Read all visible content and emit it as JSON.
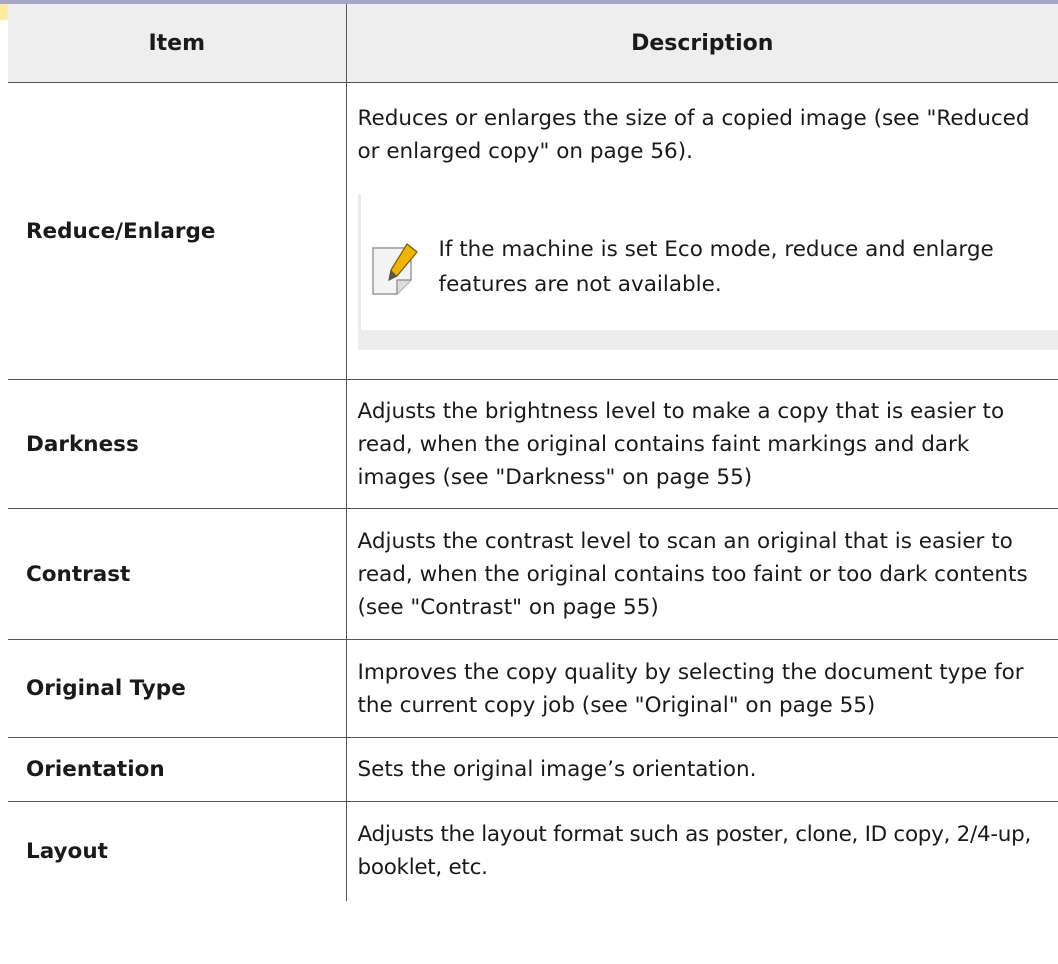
{
  "table": {
    "headers": {
      "item": "Item",
      "description": "Description"
    },
    "rows": [
      {
        "item": "Reduce/Enlarge",
        "description": "Reduces or enlarges the size of a copied image (see \"Reduced or enlarged copy\" on page 56).",
        "note": "If the machine is set Eco mode, reduce and enlarge features are not available."
      },
      {
        "item": "Darkness",
        "description": "Adjusts the brightness level to make a copy that is easier to read, when the original contains faint markings and dark images (see \"Darkness\" on page 55)"
      },
      {
        "item": "Contrast",
        "description": "Adjusts the contrast level to scan an original that is easier to read, when the original contains too faint or too dark contents (see \"Contrast\" on page 55)"
      },
      {
        "item": "Original Type",
        "description": "Improves the copy quality by selecting the document type for the current copy job (see \"Original\" on page 55)"
      },
      {
        "item": "Orientation",
        "description": "Sets the original image’s orientation."
      },
      {
        "item": "Layout",
        "description": "Adjusts the layout format such as poster, clone, ID copy, 2/4-up, booklet, etc."
      }
    ]
  },
  "icons": {
    "note": "note-pencil-icon"
  },
  "colors": {
    "header_bg": "#eeeeee",
    "top_rule": "#a6a6c7",
    "note_shade": "#ededed"
  }
}
